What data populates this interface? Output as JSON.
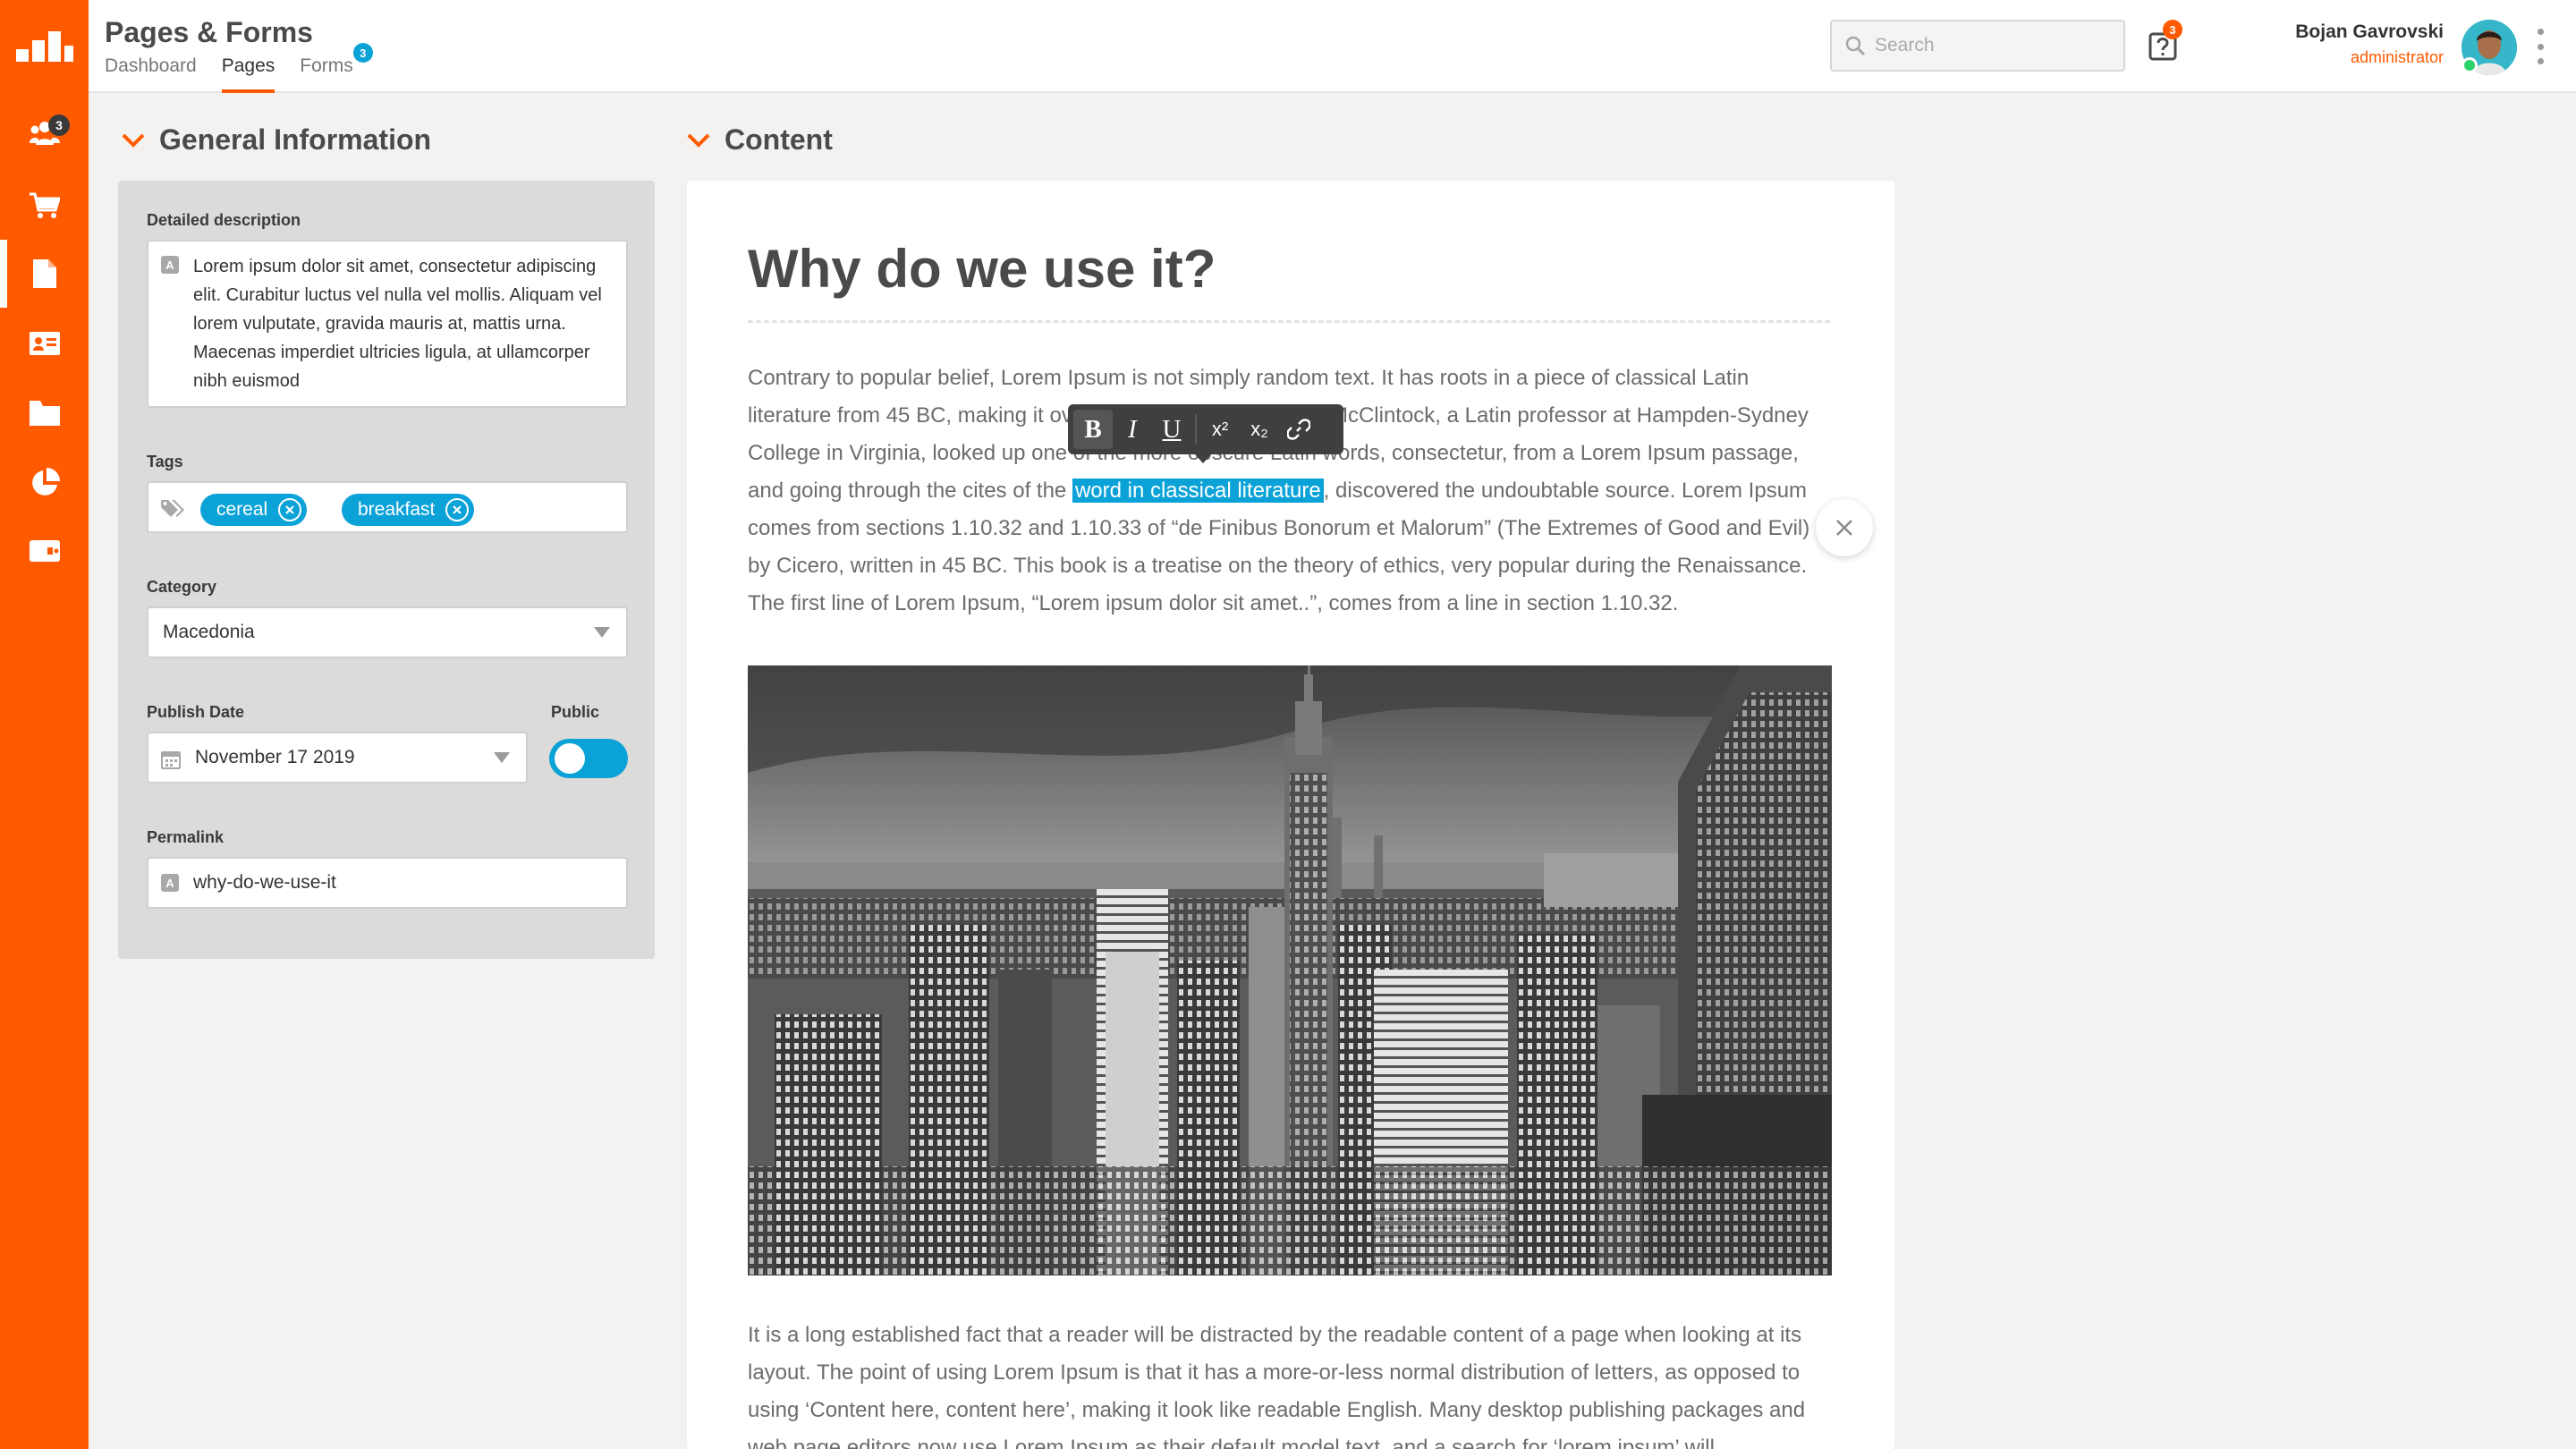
{
  "sidebar": {
    "items": [
      {
        "name": "team-icon",
        "badge": "3"
      },
      {
        "name": "cart-icon"
      },
      {
        "name": "page-icon",
        "active": true
      },
      {
        "name": "id-card-icon"
      },
      {
        "name": "folder-icon"
      },
      {
        "name": "pie-chart-icon"
      },
      {
        "name": "ticket-icon"
      }
    ]
  },
  "header": {
    "title": "Pages & Forms",
    "tabs": [
      {
        "label": "Dashboard"
      },
      {
        "label": "Pages",
        "active": true
      },
      {
        "label": "Forms",
        "badge": "3"
      }
    ],
    "search_placeholder": "Search",
    "help_badge": "3",
    "user": {
      "name": "Bojan Gavrovski",
      "role": "administrator",
      "status": "online"
    }
  },
  "general": {
    "heading": "General Information",
    "description_label": "Detailed description",
    "description": "Lorem ipsum dolor sit amet, consectetur adipiscing elit. Curabitur luctus vel nulla vel mollis. Aliquam vel lorem vulputate, gravida mauris at, mattis urna. Maecenas imperdiet ultricies ligula, at ullamcorper nibh euismod",
    "tags_label": "Tags",
    "tags": [
      "cereal",
      "breakfast"
    ],
    "category_label": "Category",
    "category_value": "Macedonia",
    "publish_date_label": "Publish Date",
    "publish_date": "November 17 2019",
    "public_label": "Public",
    "public": true,
    "permalink_label": "Permalink",
    "permalink": "why-do-we-use-it"
  },
  "content": {
    "heading": "Content",
    "title": "Why do we use it?",
    "para1_before": "Contrary to popular belief, Lorem Ipsum is not simply random text. It has roots in a piece of classical Latin literature from 45 BC, making it over 2000 years old. Richard McClintock, a Latin professor at Hampden-Sydney College in Virginia, looked up one of the more obscure Latin words, consectetur, from a Lorem Ipsum passage, and going through the cites of the ",
    "para1_highlight": "word in classical literature",
    "para1_after": ", discovered the undoubtable source. Lorem Ipsum comes from sections 1.10.32 and 1.10.33 of “de Finibus Bonorum et Malorum” (The Extremes of Good and Evil) by Cicero, written in 45 BC. This book is a treatise on the theory of ethics, very popular during the Renaissance. The first line of Lorem Ipsum, “Lorem ipsum dolor sit amet..”, comes from a line in section 1.10.32.",
    "para2": "It is a long established fact that a reader will be distracted by the readable content of a page when looking at its layout. The point of using Lorem Ipsum is that it has a more-or-less normal distribution of letters, as opposed to using ‘Content here, content here’, making it look like readable English. Many desktop publishing packages and web page editors now use Lorem Ipsum as their default model text, and a search for ‘lorem ipsum’ will",
    "toolbar": {
      "bold": "B",
      "italic": "I",
      "underline": "U",
      "superscript": "x²",
      "subscript": "x₂"
    }
  },
  "colors": {
    "brand": "#ff5a00",
    "accent": "#0ba2d8",
    "panel": "#dcdbd9",
    "toolbar": "#3f3f3f"
  }
}
